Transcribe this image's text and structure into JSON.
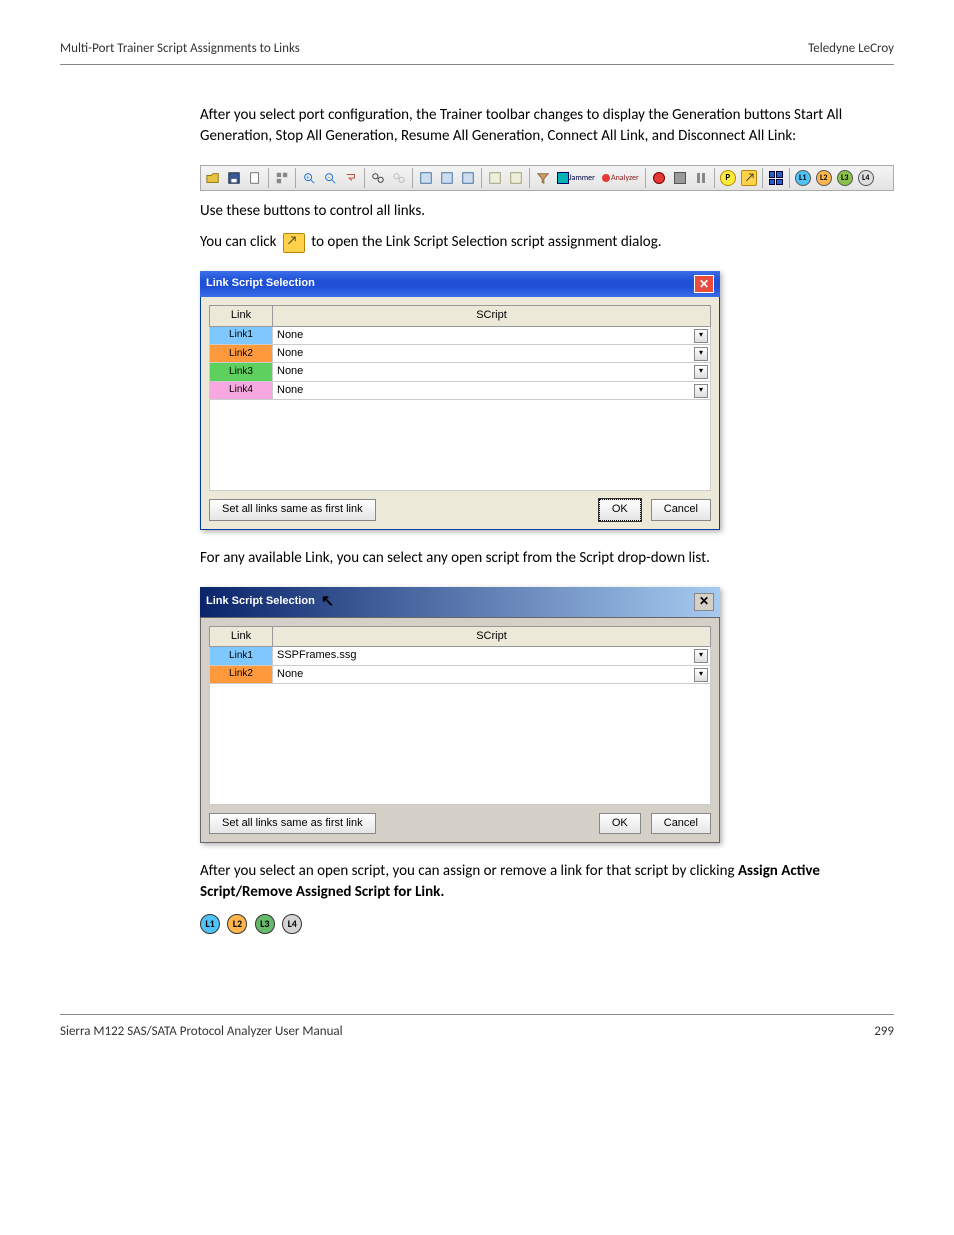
{
  "header": {
    "left": "Multi-Port Trainer Script Assignments to Links",
    "right": "Teledyne LeCroy"
  },
  "para1": "After you select port configuration, the Trainer toolbar changes to display the Generation buttons Start All Generation, Stop All Generation, Resume All Generation, Connect All Link, and Disconnect All Link:",
  "para2": "Use these buttons to control all links.",
  "para3a": "You can click ",
  "para3b": " to open the Link Script Selection script assignment dialog.",
  "dialog1": {
    "title": "Link Script Selection",
    "col_link": "Link",
    "col_script": "SCript",
    "rows": [
      {
        "link": "Link1",
        "script": "None",
        "cls": "l1"
      },
      {
        "link": "Link2",
        "script": "None",
        "cls": "l2"
      },
      {
        "link": "Link3",
        "script": "None",
        "cls": "l3"
      },
      {
        "link": "Link4",
        "script": "None",
        "cls": "l4"
      }
    ],
    "set_all": "Set all links same as first link",
    "ok": "OK",
    "cancel": "Cancel"
  },
  "para4": "For any available Link, you can select any open script from the Script drop-down list.",
  "dialog2": {
    "title": "Link Script Selection",
    "col_link": "Link",
    "col_script": "SCript",
    "rows": [
      {
        "link": "Link1",
        "script": "SSPFrames.ssg",
        "cls": "l1"
      },
      {
        "link": "Link2",
        "script": "None",
        "cls": "l2"
      }
    ],
    "set_all": "Set all links same as first link",
    "ok": "OK",
    "cancel": "Cancel"
  },
  "para5a": "After you select an open script, you can assign or remove a link for that script by clicking ",
  "para5b": "Assign Active Script/Remove Assigned Script for Link.",
  "badges": [
    "L1",
    "L2",
    "L3",
    "L4"
  ],
  "toolbar": {
    "jammer": "Jammer",
    "analyzer": "Analyzer",
    "P": "P"
  },
  "footer": {
    "left": "Sierra M122 SAS/SATA Protocol Analyzer User Manual",
    "right": "299"
  }
}
